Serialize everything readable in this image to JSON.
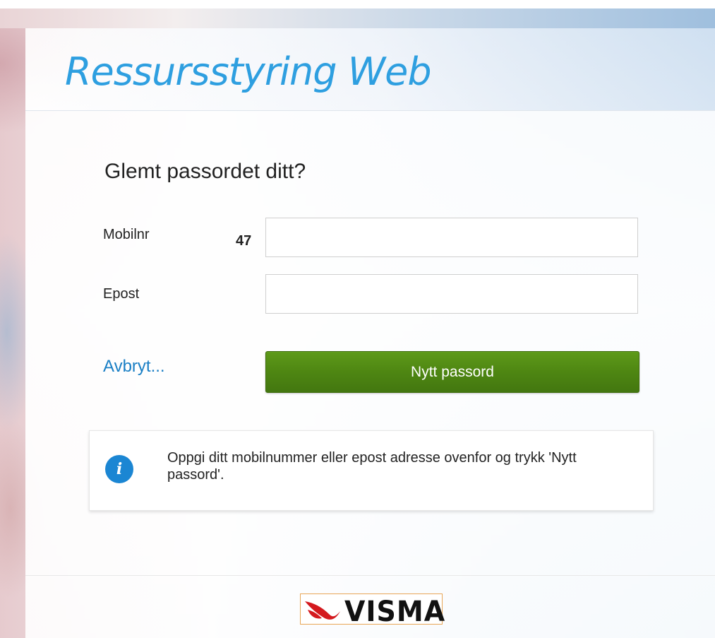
{
  "app": {
    "title": "Ressursstyring Web"
  },
  "form": {
    "heading": "Glemt passordet ditt?",
    "mobile_label": "Mobilnr",
    "mobile_prefix": "47",
    "mobile_value": "",
    "email_label": "Epost",
    "email_value": "",
    "cancel_label": "Avbryt...",
    "submit_label": "Nytt passord"
  },
  "info": {
    "icon": "info-icon",
    "icon_glyph": "i",
    "message": "Oppgi ditt mobilnummer eller epost adresse ovenfor og trykk 'Nytt passord'."
  },
  "footer": {
    "logo_text": "VISMA"
  },
  "colors": {
    "title_blue": "#2e9fe0",
    "link_blue": "#1a7fc5",
    "button_green": "#4e8612",
    "info_blue": "#1b86d3",
    "visma_red": "#d4191e"
  }
}
